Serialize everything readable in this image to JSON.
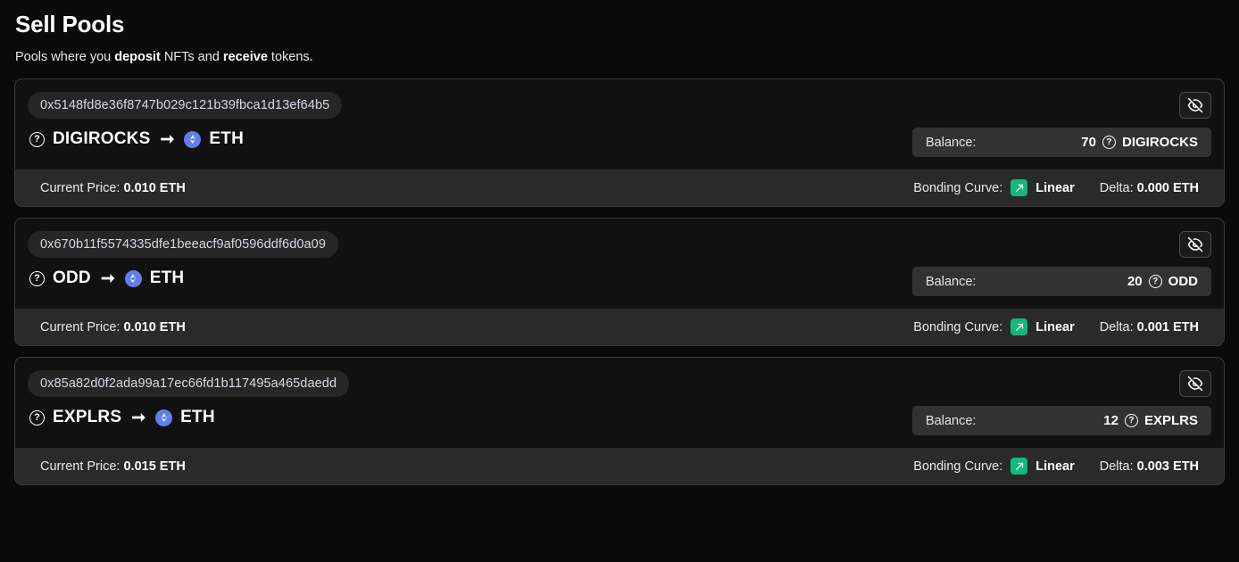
{
  "header": {
    "title": "Sell Pools",
    "subtitle_parts": {
      "lead": "Pools where you ",
      "bold1": "deposit",
      "mid": " NFTs and ",
      "bold2": "receive",
      "tail": " tokens."
    }
  },
  "labels": {
    "balance": "Balance:",
    "current_price_label": "Current Price:",
    "bonding_curve_label": "Bonding Curve:",
    "delta_label": "Delta:",
    "quote_symbol": "ETH",
    "arrow": "➞",
    "qmark": "?"
  },
  "icons": {
    "hide": "eye-off-icon",
    "curve": "trending-up-icon",
    "eth": "ethereum-logo-icon",
    "unknown_token": "question-circle-icon"
  },
  "colors": {
    "page_bg": "#0a0a0a",
    "card_bg": "#111111",
    "card_border": "#3a3a3a",
    "pill_bg": "#262626",
    "balance_bg": "#323232",
    "strip_bg": "#2a2a2a",
    "curve_accent": "#14b87c",
    "eth_accent": "#627eea"
  },
  "pools": [
    {
      "address": "0x5148fd8e36f8747b029c121b39fbca1d13ef64b5",
      "base_symbol": "DIGIROCKS",
      "quote_symbol": "ETH",
      "balance_amount": "70",
      "balance_symbol": "DIGIROCKS",
      "current_price": "0.010 ETH",
      "bonding_curve": "Linear",
      "delta": "0.000 ETH"
    },
    {
      "address": "0x670b11f5574335dfe1beeacf9af0596ddf6d0a09",
      "base_symbol": "ODD",
      "quote_symbol": "ETH",
      "balance_amount": "20",
      "balance_symbol": "ODD",
      "current_price": "0.010 ETH",
      "bonding_curve": "Linear",
      "delta": "0.001 ETH"
    },
    {
      "address": "0x85a82d0f2ada99a17ec66fd1b117495a465daedd",
      "base_symbol": "EXPLRS",
      "quote_symbol": "ETH",
      "balance_amount": "12",
      "balance_symbol": "EXPLRS",
      "current_price": "0.015 ETH",
      "bonding_curve": "Linear",
      "delta": "0.003 ETH"
    }
  ]
}
